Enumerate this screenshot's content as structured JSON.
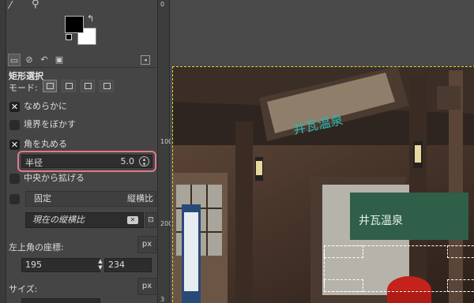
{
  "toolbox": {
    "tools": [
      "fuzzy-select-icon",
      "zoom-icon"
    ],
    "swap_glyph": "↰"
  },
  "tabs": {
    "menu_glyph": "◂"
  },
  "tool_options": {
    "title": "矩形選択",
    "mode_label": "モード:",
    "antialias": {
      "label": "なめらかに",
      "checked": true
    },
    "feather": {
      "label": "境界をぼかす",
      "checked": false
    },
    "rounded": {
      "label": "角を丸める",
      "checked": true
    },
    "radius": {
      "label": "半径",
      "value": "5.0"
    },
    "expand_center": {
      "label": "中央から拡げる",
      "checked": false
    },
    "fixed": {
      "label": "固定",
      "value": "縦横比"
    },
    "aspect_entry": {
      "placeholder": "現在の縦横比"
    },
    "position": {
      "label": "左上角の座標:",
      "unit": "px",
      "x": "195",
      "y": "234"
    },
    "size": {
      "label": "サイズ:",
      "unit": "px"
    }
  },
  "ruler": {
    "vertical_labels": [
      "0",
      "100",
      "200",
      "3"
    ]
  },
  "canvas": {
    "sign_text": "井瓦温泉",
    "banner_text": "井瓦温泉"
  },
  "colors": {
    "panel": "#454545",
    "highlight": "#e07a88",
    "foreground": "#000000",
    "background": "#ffffff"
  }
}
